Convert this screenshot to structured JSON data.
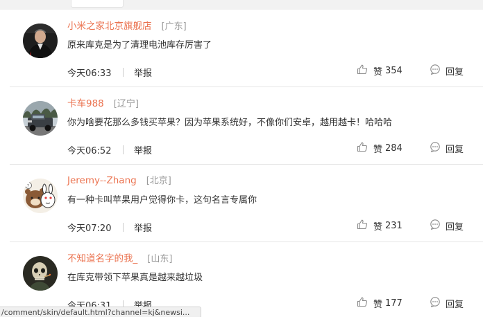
{
  "comments": [
    {
      "name": "小米之家北京旗舰店",
      "location": "[广东]",
      "text": "原来库克是为了清理电池库存厉害了",
      "time": "今天06:33",
      "report": "举报",
      "like_label": "赞",
      "like_count": "354",
      "reply_label": "回复",
      "avatar": "person-in-dark-suit"
    },
    {
      "name": "卡车988",
      "location": "[辽宁]",
      "text": "你为啥要花那么多钱买苹果？因为苹果系统好，不像你们安卓，越用越卡！哈哈哈",
      "time": "今天06:52",
      "report": "举报",
      "like_label": "赞",
      "like_count": "284",
      "reply_label": "回复",
      "avatar": "pickup-truck"
    },
    {
      "name": "Jeremy--Zhang",
      "location": "[北京]",
      "text": "有一种卡叫苹果用户觉得你卡，这句名言专属你",
      "time": "今天07:20",
      "report": "举报",
      "like_label": "赞",
      "like_count": "231",
      "reply_label": "回复",
      "avatar": "cartoon-bear-and-bunny"
    },
    {
      "name": "不知道名字的我_",
      "location": "[山东]",
      "text": "在库克带领下苹果真是越来越垃圾",
      "time": "今天06:31",
      "report": "举报",
      "like_label": "赞",
      "like_count": "177",
      "reply_label": "回复",
      "avatar": "skull-painting"
    }
  ],
  "status_url": "/comment/skin/default.html?channel=kj&newsi...",
  "colors": {
    "username": "#eb7350",
    "location": "#999999",
    "divider": "#e6e6e6"
  }
}
